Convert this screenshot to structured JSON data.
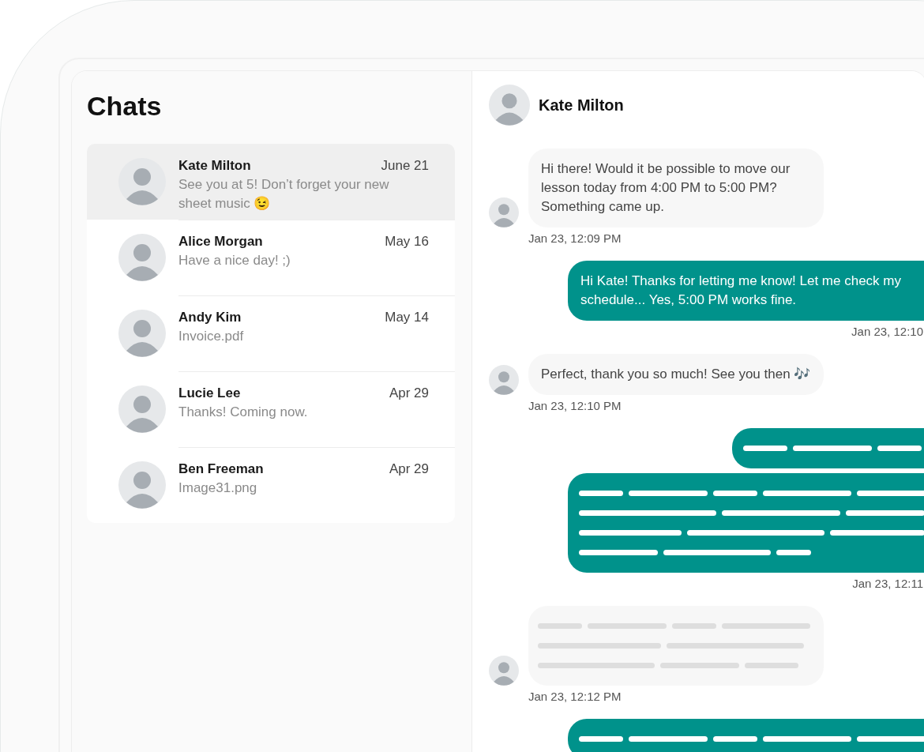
{
  "sidebar": {
    "title": "Chats",
    "chats": [
      {
        "name": "Kate Milton",
        "date": "June 21",
        "preview": "See you at 5! Don’t forget your new sheet music 😉",
        "selected": true
      },
      {
        "name": "Alice Morgan",
        "date": "May 16",
        "preview": "Have a nice day! ;)",
        "selected": false
      },
      {
        "name": "Andy Kim",
        "date": "May 14",
        "preview": "Invoice.pdf",
        "selected": false
      },
      {
        "name": "Lucie Lee",
        "date": "Apr 29",
        "preview": "Thanks! Coming now.",
        "selected": false
      },
      {
        "name": "Ben Freeman",
        "date": "Apr 29",
        "preview": "Image31.png",
        "selected": false
      }
    ]
  },
  "conversation": {
    "contact": "Kate Milton",
    "messages": [
      {
        "outgoing": false,
        "kind": "text",
        "text": "Hi there! Would it be possible to move our lesson today from 4:00 PM to 5:00 PM? Something came up.",
        "time": "Jan 23, 12:09 PM"
      },
      {
        "outgoing": true,
        "kind": "text",
        "text": "Hi Kate! Thanks for letting me know! Let me check my schedule... Yes, 5:00 PM works fine.",
        "time": "Jan 23, 12:10"
      },
      {
        "outgoing": false,
        "kind": "text",
        "text": "Perfect, thank you so much! See you then 🎶",
        "time": "Jan 23, 12:10 PM"
      },
      {
        "outgoing": true,
        "kind": "placeholder"
      },
      {
        "outgoing": true,
        "kind": "placeholder",
        "time": "Jan 23, 12:11"
      },
      {
        "outgoing": false,
        "kind": "placeholder",
        "time": "Jan 23, 12:12 PM"
      },
      {
        "outgoing": true,
        "kind": "placeholder"
      }
    ]
  }
}
